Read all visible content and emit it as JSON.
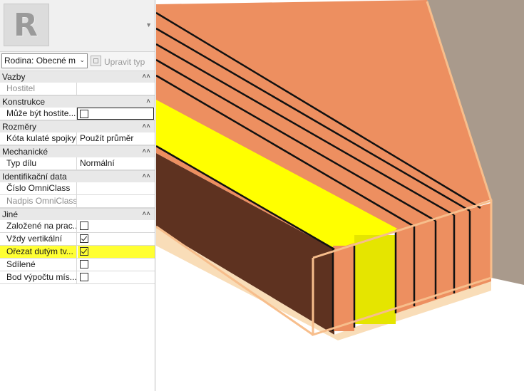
{
  "colors": {
    "copper": "#ED8F60",
    "yellow": "#FFFF00",
    "highlight": "#FFFF33",
    "dark_brown": "#5E3220",
    "gray_face": "#A99A8C",
    "outline": "#F7BE8C"
  },
  "type_preview": {
    "logo": "R",
    "dropdown_icon": "triangle-down-icon"
  },
  "type_selector": {
    "family": "Rodina: Obecné m",
    "edit_type": "Upravit typ"
  },
  "groups": {
    "vazby": {
      "label": "Vazby",
      "rows": [
        {
          "label": "Hostitel",
          "value": ""
        }
      ]
    },
    "konstrukce": {
      "label": "Konstrukce",
      "rows": [
        {
          "label": "Může být hostite...",
          "checked": false
        }
      ]
    },
    "rozmery": {
      "label": "Rozměry",
      "rows": [
        {
          "label": "Kóta kulaté spojky",
          "value": "Použít průměr"
        }
      ]
    },
    "mechanicke": {
      "label": "Mechanické",
      "rows": [
        {
          "label": "Typ dílu",
          "value": "Normální"
        }
      ]
    },
    "identifikacni": {
      "label": "Identifikační data",
      "rows": [
        {
          "label": "Číslo OmniClass",
          "value": ""
        },
        {
          "label": "Nadpis OmniClass",
          "value": ""
        }
      ]
    },
    "jine": {
      "label": "Jiné",
      "rows": [
        {
          "label": "Založené na prac...",
          "checked": false
        },
        {
          "label": "Vždy vertikální",
          "checked": true
        },
        {
          "label": "Ořezat dutým tv...",
          "checked": true
        },
        {
          "label": "Sdílené",
          "checked": false
        },
        {
          "label": "Bod výpočtu mís...",
          "checked": false
        }
      ]
    }
  }
}
